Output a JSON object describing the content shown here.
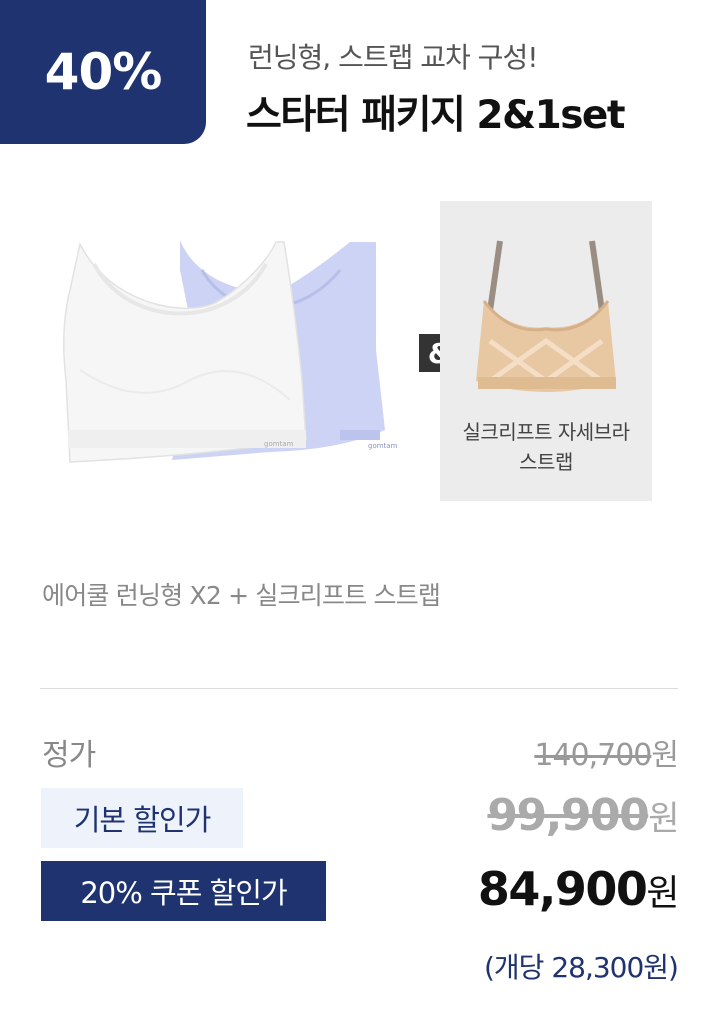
{
  "badge": {
    "text": "40%"
  },
  "header": {
    "subtitle": "런닝형, 스트랩 교차 구성!",
    "title": "스타터 패키지 2&1set"
  },
  "products": {
    "ampersand": "&",
    "strap_label_line1": "실크리프트 자세브라",
    "strap_label_line2": "스트랩"
  },
  "description": "에어쿨 런닝형 X2 + 실크리프트 스트랩",
  "pricing": {
    "regular_label": "정가",
    "regular_price": "140,700",
    "basic_label": "기본 할인가",
    "basic_price": "99,900",
    "coupon_label": "20% 쿠폰 할인가",
    "final_price": "84,900",
    "currency": "원",
    "per_unit": "(개당 28,300원)"
  },
  "colors": {
    "navy": "#1f3370",
    "light_blue_chip": "#eef3fb",
    "bra_white": "#f6f6f6",
    "bra_lavender": "#cdd3f4",
    "bra_beige": "#e8c8a2"
  },
  "icons": {
    "white_bra": "running-bra-white-image",
    "lavender_bra": "running-bra-lavender-image",
    "strap_bra": "strap-bra-beige-image"
  }
}
